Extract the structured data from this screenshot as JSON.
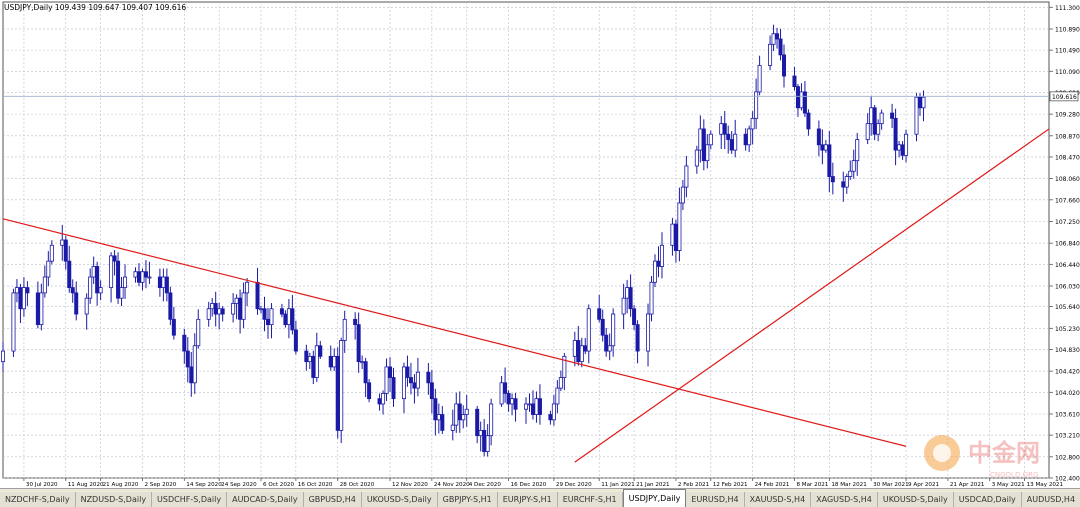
{
  "chart_title": "USDJPY,Daily  109.439 109.647 109.407 109.616",
  "tabs": [
    "NZDCHF-S,Daily",
    "NZDUSD-S,Daily",
    "USDCHF-S,Daily",
    "AUDCAD-S,Daily",
    "GBPUSD,H4",
    "UKOUSD-S,Daily",
    "GBPJPY-S,H1",
    "EURJPY-S,H1",
    "EURCHF-S,H1",
    "USDJPY,Daily",
    "EURUSD,H4",
    "XAUUSD-S,H4",
    "XAGUSD-S,H4",
    "UKOUSD-S,Daily",
    "USDCAD,Daily",
    "AUDUSD,H4"
  ],
  "active_tab": "USDJPY,Daily",
  "watermark": {
    "logo_text": "中金网",
    "sub_text": "CNGOLD.ORG"
  },
  "colors": {
    "candle": "#1a1aa6",
    "trendline": "#e01818",
    "grid": "#b8c0cc",
    "current_price_line": "#9ab0cc"
  },
  "chart_data": {
    "type": "candlestick",
    "symbol": "USDJPY",
    "timeframe": "Daily",
    "ohlc_header": {
      "open": 109.439,
      "high": 109.647,
      "low": 109.407,
      "close": 109.616
    },
    "current_price": 109.616,
    "ylim": [
      102.4,
      111.4
    ],
    "y_ticks": [
      111.3,
      110.89,
      110.49,
      110.09,
      109.69,
      109.28,
      108.87,
      108.47,
      108.06,
      107.66,
      107.25,
      106.84,
      106.44,
      106.03,
      105.64,
      105.23,
      104.83,
      104.42,
      104.02,
      103.61,
      103.21,
      102.8,
      102.4
    ],
    "x_ticks": [
      "30 Jul 2020",
      "11 Aug 2020",
      "21 Aug 2020",
      "2 Sep 2020",
      "14 Sep 2020",
      "24 Sep 2020",
      "6 Oct 2020",
      "16 Oct 2020",
      "28 Oct 2020",
      "12 Nov 2020",
      "24 Nov 2020",
      "4 Dec 2020",
      "16 Dec 2020",
      "29 Dec 2020",
      "11 Jan 2021",
      "21 Jan 2021",
      "2 Feb 2021",
      "12 Feb 2021",
      "24 Feb 2021",
      "8 Mar 2021",
      "18 Mar 2021",
      "30 Mar 2021",
      "9 Apr 2021",
      "21 Apr 2021",
      "3 May 2021",
      "13 May 2021"
    ],
    "closes": [
      104.8,
      105.9,
      106.0,
      105.6,
      106.0,
      105.9,
      105.3,
      105.9,
      106.2,
      106.5,
      106.8,
      106.9,
      106.5,
      106.0,
      105.9,
      105.5,
      105.8,
      106.2,
      106.4,
      105.9,
      106.0,
      106.6,
      106.5,
      105.8,
      106.0,
      106.2,
      106.3,
      106.1,
      106.3,
      106.2,
      106.2,
      106.0,
      106.2,
      105.9,
      105.4,
      105.1,
      104.8,
      104.5,
      104.2,
      104.9,
      105.4,
      105.6,
      105.7,
      105.5,
      105.6,
      105.5,
      105.7,
      105.8,
      105.4,
      105.9,
      106.1,
      105.6,
      105.6,
      105.4,
      105.3,
      105.6,
      105.5,
      105.3,
      105.6,
      105.2,
      104.8,
      104.6,
      104.7,
      104.3,
      104.9,
      104.7,
      104.5,
      104.7,
      103.3,
      105.0,
      105.4,
      105.3,
      104.6,
      104.6,
      104.2,
      103.9,
      103.8,
      104.0,
      104.5,
      104.3,
      103.9,
      104.5,
      104.3,
      104.2,
      104.1,
      104.4,
      104.2,
      103.9,
      103.5,
      103.6,
      103.3,
      103.4,
      103.8,
      103.5,
      103.6,
      103.7,
      103.2,
      103.3,
      102.9,
      103.2,
      103.8,
      104.2,
      104.0,
      103.8,
      103.9,
      103.7,
      103.8,
      103.8,
      103.6,
      103.9,
      103.6,
      103.5,
      103.8,
      104.1,
      104.3,
      104.7,
      105.0,
      104.6,
      104.9,
      104.8,
      105.6,
      105.4,
      105.1,
      104.8,
      104.9,
      105.5,
      105.8,
      106.0,
      105.6,
      105.3,
      104.8,
      105.5,
      106.1,
      106.5,
      106.4,
      106.8,
      107.2,
      106.7,
      107.6,
      107.9,
      108.3,
      108.6,
      109.0,
      108.4,
      108.7,
      108.9,
      109.1,
      108.9,
      108.8,
      108.6,
      108.9,
      108.7,
      109.0,
      109.2,
      109.7,
      110.2,
      110.6,
      110.8,
      110.7,
      110.4,
      110.0,
      109.8,
      109.4,
      109.7,
      109.3,
      109.0,
      108.7,
      108.6,
      108.7,
      108.1,
      108.0,
      107.9,
      108.1,
      108.2,
      108.4,
      108.8,
      109.1,
      109.4,
      108.9,
      109.1,
      109.3,
      109.2,
      108.6,
      108.7,
      108.5,
      108.9,
      109.6,
      109.4,
      109.6
    ],
    "trendlines": [
      {
        "from": {
          "date": "24 Jul 2020",
          "price": 107.3
        },
        "to": {
          "date": "9 Apr 2021",
          "price": 103.0
        }
      },
      {
        "from": {
          "date": "4 Jan 2021",
          "price": 102.7
        },
        "to": {
          "date": "20 May 2021",
          "price": 109.0
        }
      }
    ]
  }
}
